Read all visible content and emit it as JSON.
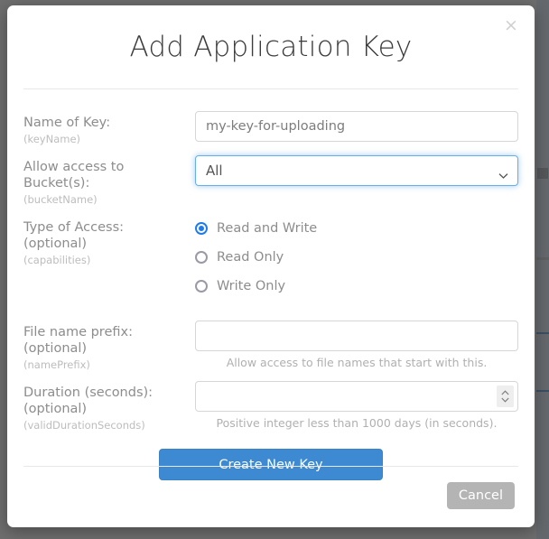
{
  "dialog": {
    "title": "Add Application Key",
    "close_icon": "close-icon",
    "close_label": "×"
  },
  "form": {
    "fields": [
      {
        "label": "Name of Key:",
        "code": "(keyName)",
        "value": "my-key-for-uploading",
        "placeholder": ""
      },
      {
        "label": "Allow access to Bucket(s):",
        "code": "(bucketName)",
        "value": "All",
        "options": [
          "All"
        ]
      },
      {
        "label": "Type of Access:",
        "label2": "(optional)",
        "code": "(capabilities)"
      },
      {
        "label": "File name prefix:",
        "label2": "(optional)",
        "code": "(namePrefix)",
        "value": "",
        "placeholder": "",
        "help": "Allow access to file names that start with this."
      },
      {
        "label": "Duration (seconds):",
        "label2": "(optional)",
        "code": "(validDurationSeconds)",
        "value": "",
        "placeholder": "",
        "help": "Positive integer less than 1000 days (in seconds).",
        "spinner_icon": "spinner-updown-icon"
      }
    ],
    "access_options": [
      {
        "label": "Read and Write",
        "selected": true
      },
      {
        "label": "Read Only",
        "selected": false
      },
      {
        "label": "Write Only",
        "selected": false
      }
    ]
  },
  "actions": {
    "submit_label": "Create New Key",
    "cancel_label": "Cancel"
  },
  "colors": {
    "primary": "#3d8ad2",
    "focus_border": "#66afe9",
    "radio_selected": "#1f7bea",
    "cancel_gray": "#b4b4b4",
    "label_gray": "#8d8d8d",
    "code_gray": "#bdbdbd",
    "backdrop": "#6e6e6e"
  }
}
